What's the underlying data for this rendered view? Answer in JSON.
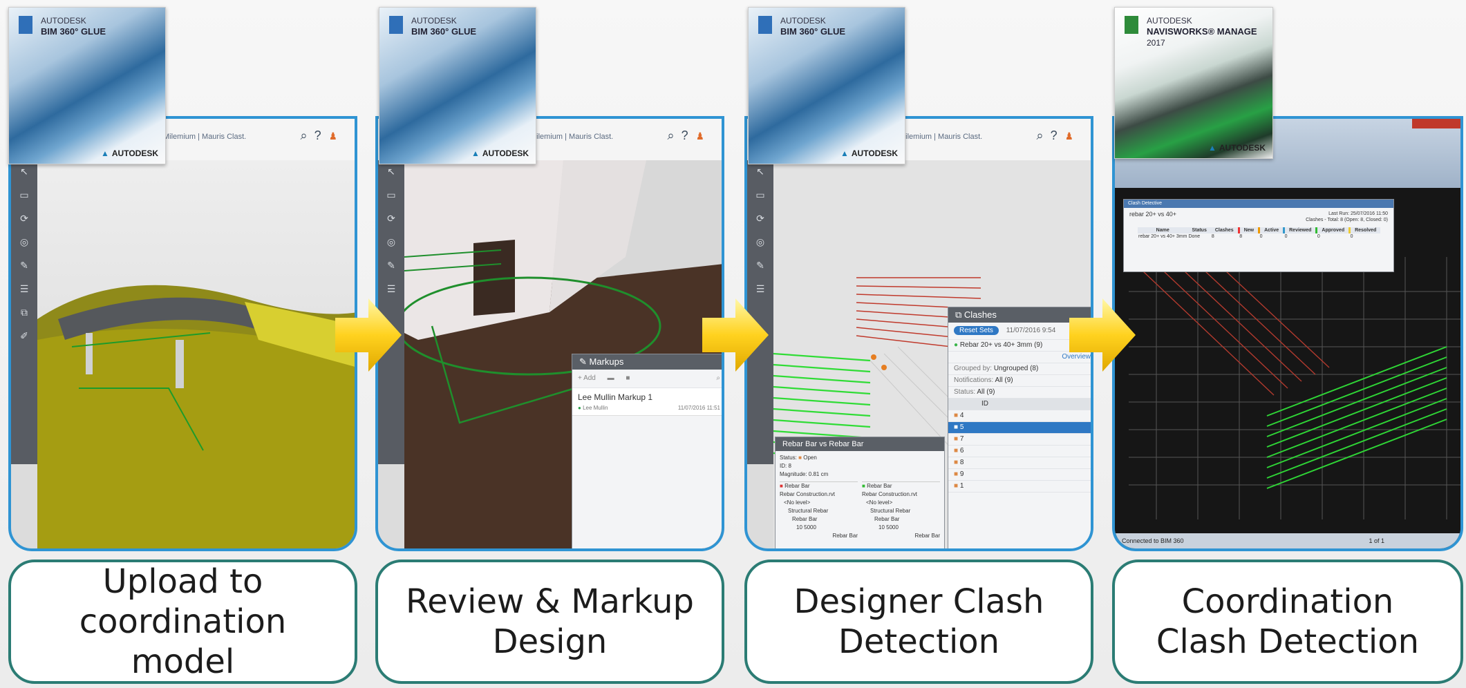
{
  "logos": [
    {
      "vendor": "AUTODESK",
      "product": "BIM 360° GLUE",
      "year": "",
      "footer": "AUTODESK"
    },
    {
      "vendor": "AUTODESK",
      "product": "BIM 360° GLUE",
      "year": "",
      "footer": "AUTODESK"
    },
    {
      "vendor": "AUTODESK",
      "product": "BIM 360° GLUE",
      "year": "",
      "footer": "AUTODESK"
    },
    {
      "vendor": "AUTODESK",
      "product": "NAVISWORKS® MANAGE",
      "year": "2017",
      "footer": "AUTODESK"
    }
  ],
  "glue_header": {
    "breadcrumb": "Milemium  |  Mauris Clast.",
    "toolbar_icons": [
      "search-icon",
      "help-icon",
      "user-icon"
    ]
  },
  "captions": [
    "Upload to\ncoordination\nmodel",
    "Review & Markup\nDesign",
    "Designer Clash\nDetection",
    "Coordination\nClash Detection"
  ],
  "markups_panel": {
    "title": "Markups",
    "add_label": "+ Add",
    "item_title": "Lee Mullin Markup 1",
    "item_author": "Lee Mullin",
    "item_date": "11/07/2016 11:51"
  },
  "clashes_panel": {
    "title": "Clashes",
    "reset_button": "Reset Sets",
    "date": "11/07/2016 9:54",
    "test_name": "Rebar 20+ vs 40+ 3mm (9)",
    "overview_link": "Overview",
    "grouped_by_label": "Grouped by:",
    "grouped_by_value": "Ungrouped (8)",
    "notifications_label": "Notifications:",
    "notifications_value": "All (9)",
    "status_label": "Status:",
    "status_value": "All (9)",
    "column_id": "ID",
    "row_ids": [
      "4",
      "5",
      "7",
      "6",
      "8",
      "9",
      "1"
    ]
  },
  "rebar_panel": {
    "title": "Rebar Bar vs Rebar Bar",
    "status_label": "Status:",
    "status_value": "Open",
    "id_line": "ID: 8",
    "magnitude": "Magnitude: 0.81 cm",
    "left_title": "Rebar Bar",
    "right_title": "Rebar Bar",
    "tree": [
      "Rebar Construction.rvt",
      "<No level>",
      "Structural Rebar",
      "Rebar Bar",
      "10 5000",
      "Rebar Bar"
    ]
  },
  "clash_detective": {
    "title": "Clash Detective",
    "test": "rebar 20+ vs 40+",
    "last_run": "Last Run: 25/07/2016 11:50",
    "summary": "Clashes - Total: 8 (Open: 8, Closed: 0)",
    "columns": [
      "Name",
      "Status",
      "Clashes",
      "New",
      "Active",
      "Reviewed",
      "Approved",
      "Resolved"
    ],
    "row": [
      "rebar 20+ vs 40+ 3mm",
      "Done",
      "8",
      "8",
      "0",
      "0",
      "0",
      "0"
    ]
  },
  "navis_status": {
    "left": "Connected to BIM 360",
    "right": "1 of 1"
  },
  "colors": {
    "panel_border": "#2f94d3",
    "caption_border": "#2b7c74",
    "arrow": "#ffd21f"
  }
}
